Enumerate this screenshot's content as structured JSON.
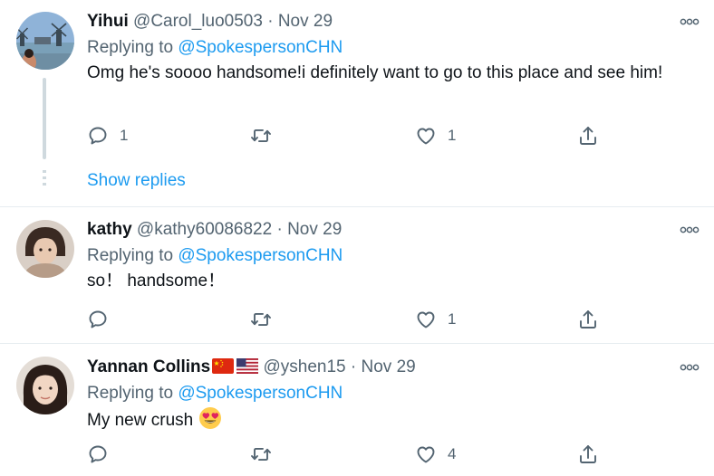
{
  "tweets": [
    {
      "name": "Yihui",
      "handle": "@Carol_luo0503",
      "separator": "·",
      "date": "Nov 29",
      "replying_prefix": "Replying to",
      "replying_to": "@SpokespersonCHN",
      "text": "Omg he's soooo handsome!i definitely want to go to this place and see him!",
      "reply_count": "1",
      "retweet_count": "",
      "like_count": "1"
    },
    {
      "name": "kathy",
      "handle": "@kathy60086822",
      "separator": "·",
      "date": "Nov 29",
      "replying_prefix": "Replying to",
      "replying_to": "@SpokespersonCHN",
      "text": "so！ handsome！",
      "reply_count": "",
      "retweet_count": "",
      "like_count": "1"
    },
    {
      "name": "Yannan Collins",
      "handle": "@yshen15",
      "separator": "·",
      "date": "Nov 29",
      "replying_prefix": "Replying to",
      "replying_to": "@SpokespersonCHN",
      "text": "My new crush",
      "reply_count": "",
      "retweet_count": "",
      "like_count": "4"
    }
  ],
  "show_replies_label": "Show replies",
  "icons": {
    "reply": "reply-icon",
    "retweet": "retweet-icon",
    "like": "heart-icon",
    "share": "share-icon",
    "more": "more-options-icon"
  },
  "colors": {
    "link": "#1d9bf0",
    "secondary": "#536471",
    "divider": "#e6ecf0"
  }
}
